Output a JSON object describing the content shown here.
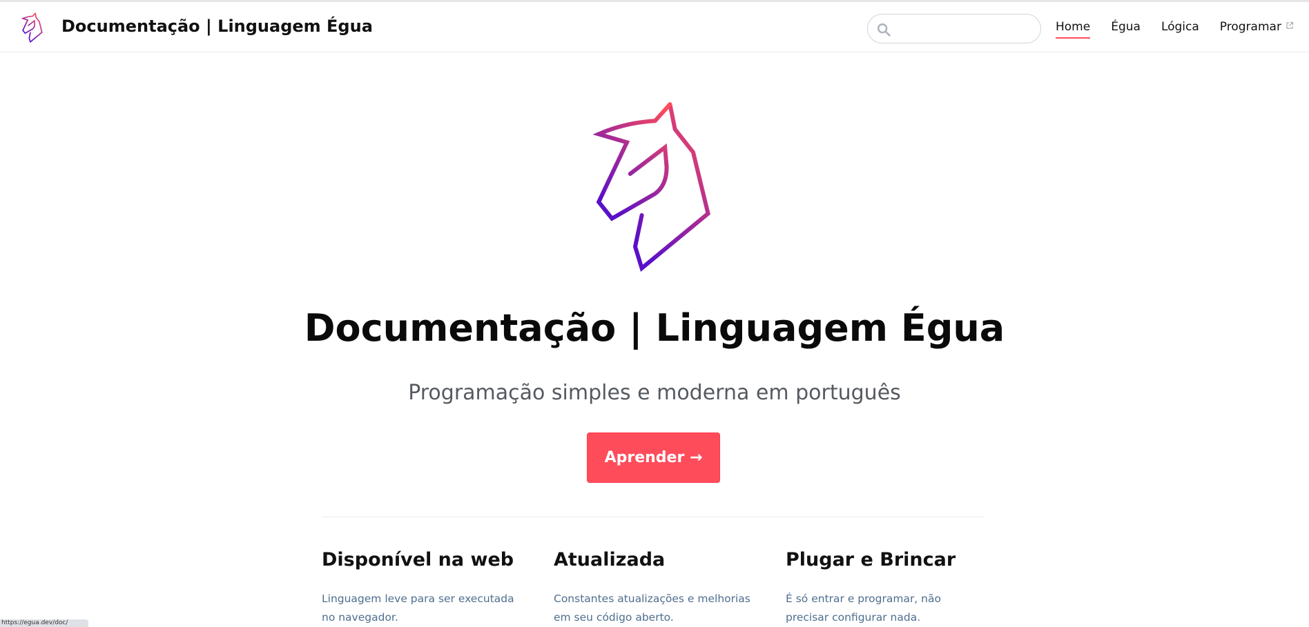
{
  "navbar": {
    "title": "Documentação | Linguagem Égua",
    "search": {
      "placeholder": "",
      "value": ""
    },
    "links": [
      {
        "label": "Home",
        "active": true,
        "external": false
      },
      {
        "label": "Égua",
        "active": false,
        "external": false
      },
      {
        "label": "Lógica",
        "active": false,
        "external": false
      },
      {
        "label": "Programar",
        "active": false,
        "external": true
      }
    ]
  },
  "hero": {
    "title": "Documentação | Linguagem Égua",
    "tagline": "Programação simples e moderna em português",
    "action_label": "Aprender →"
  },
  "features": [
    {
      "title": "Disponível na web",
      "details": "Linguagem leve para ser executada no navegador."
    },
    {
      "title": "Atualizada",
      "details": "Constantes atualizações e melhorias em seu código aberto."
    },
    {
      "title": "Plugar e Brincar",
      "details": "É só entrar e programar, não precisar configurar nada."
    }
  ],
  "status_bar": {
    "url": "https://egua.dev/doc/"
  },
  "colors": {
    "accent": "#ff4c5b",
    "logo_gradient_start": "#ff4c5b",
    "logo_gradient_end": "#5a0fc8",
    "text_dark": "#111111",
    "text_muted": "#4e6e8e"
  },
  "icons": {
    "logo": "horse-head-icon",
    "search": "search-icon",
    "external_link": "external-link-icon"
  }
}
